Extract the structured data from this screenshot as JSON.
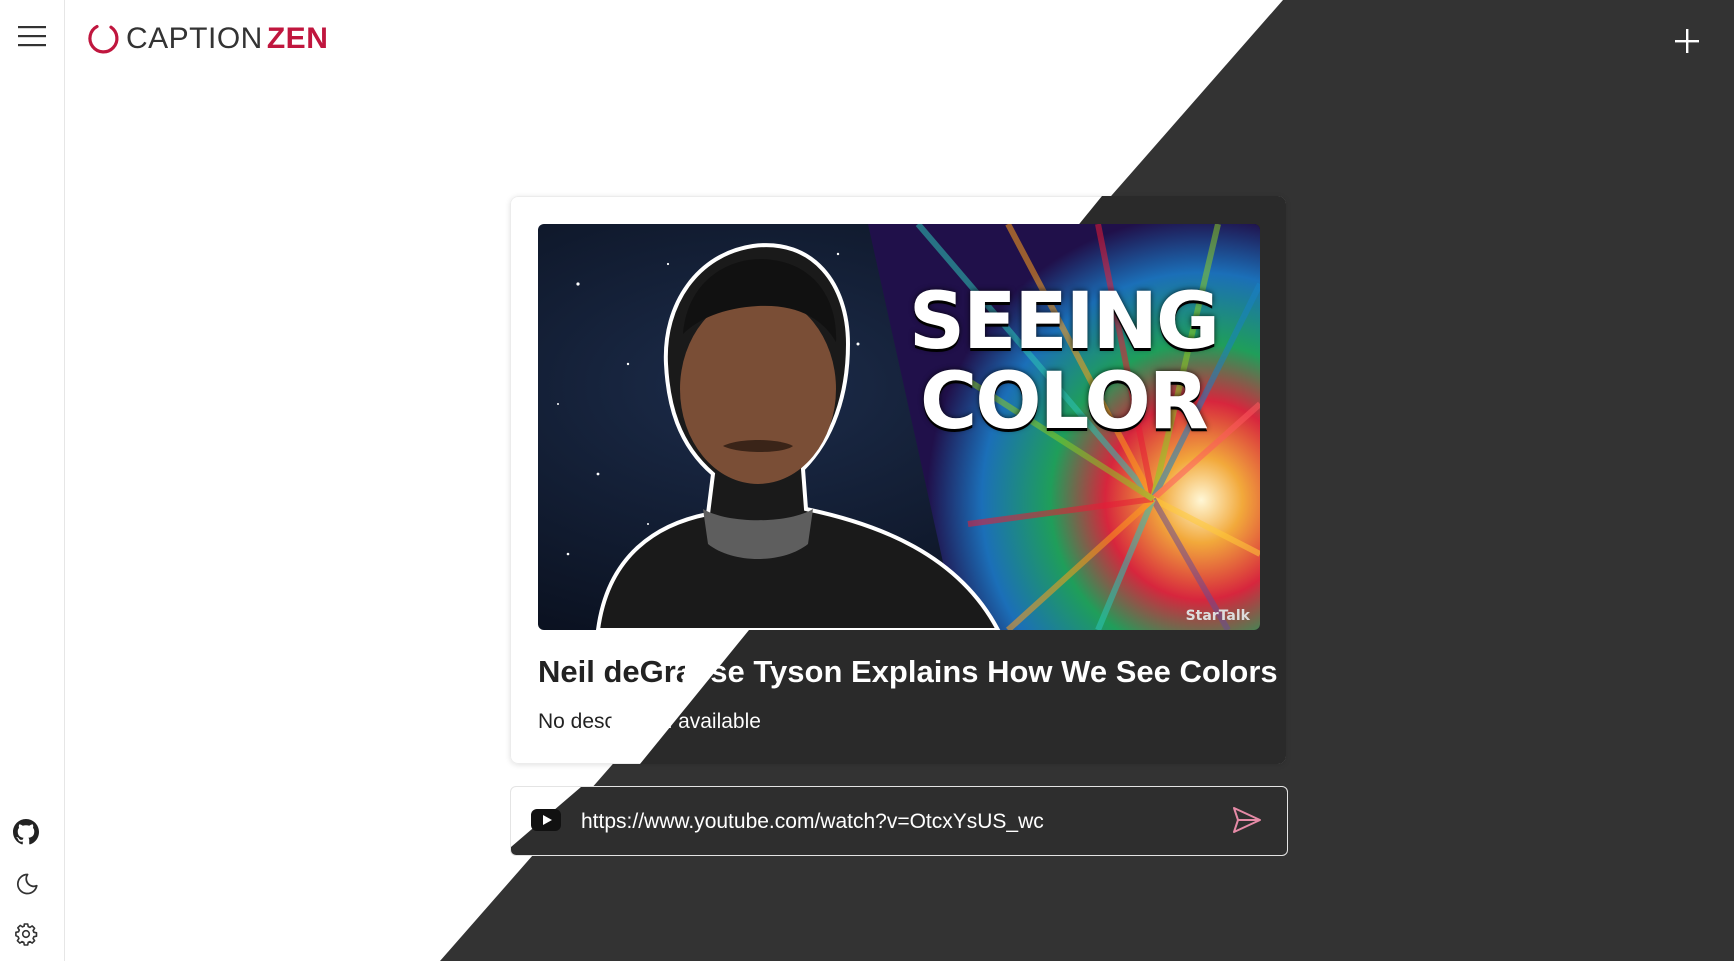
{
  "app": {
    "logo_part1": "CAPTION",
    "logo_part2": "ZEN",
    "brand_color": "#c0163e"
  },
  "sidebar": {
    "icons": [
      "menu-icon",
      "github-icon",
      "moon-icon",
      "gear-icon"
    ]
  },
  "header": {
    "new_icon": "plus-icon"
  },
  "video": {
    "thumbnail_title": "SEEING COLOR",
    "thumbnail_line1": "SEEING",
    "thumbnail_line2": "COLOR",
    "thumbnail_brand": "StarTalk",
    "title": "Neil deGrasse Tyson Explains How We See Colors",
    "description": "No description available"
  },
  "input": {
    "source_icon": "youtube-icon",
    "value": "https://www.youtube.com/watch?v=OtcxYsUS_wc",
    "send_icon": "send-icon"
  },
  "colors": {
    "dark_bg": "#333333",
    "card_dark": "#2a2a2a",
    "send_icon": "#e58aa6"
  }
}
